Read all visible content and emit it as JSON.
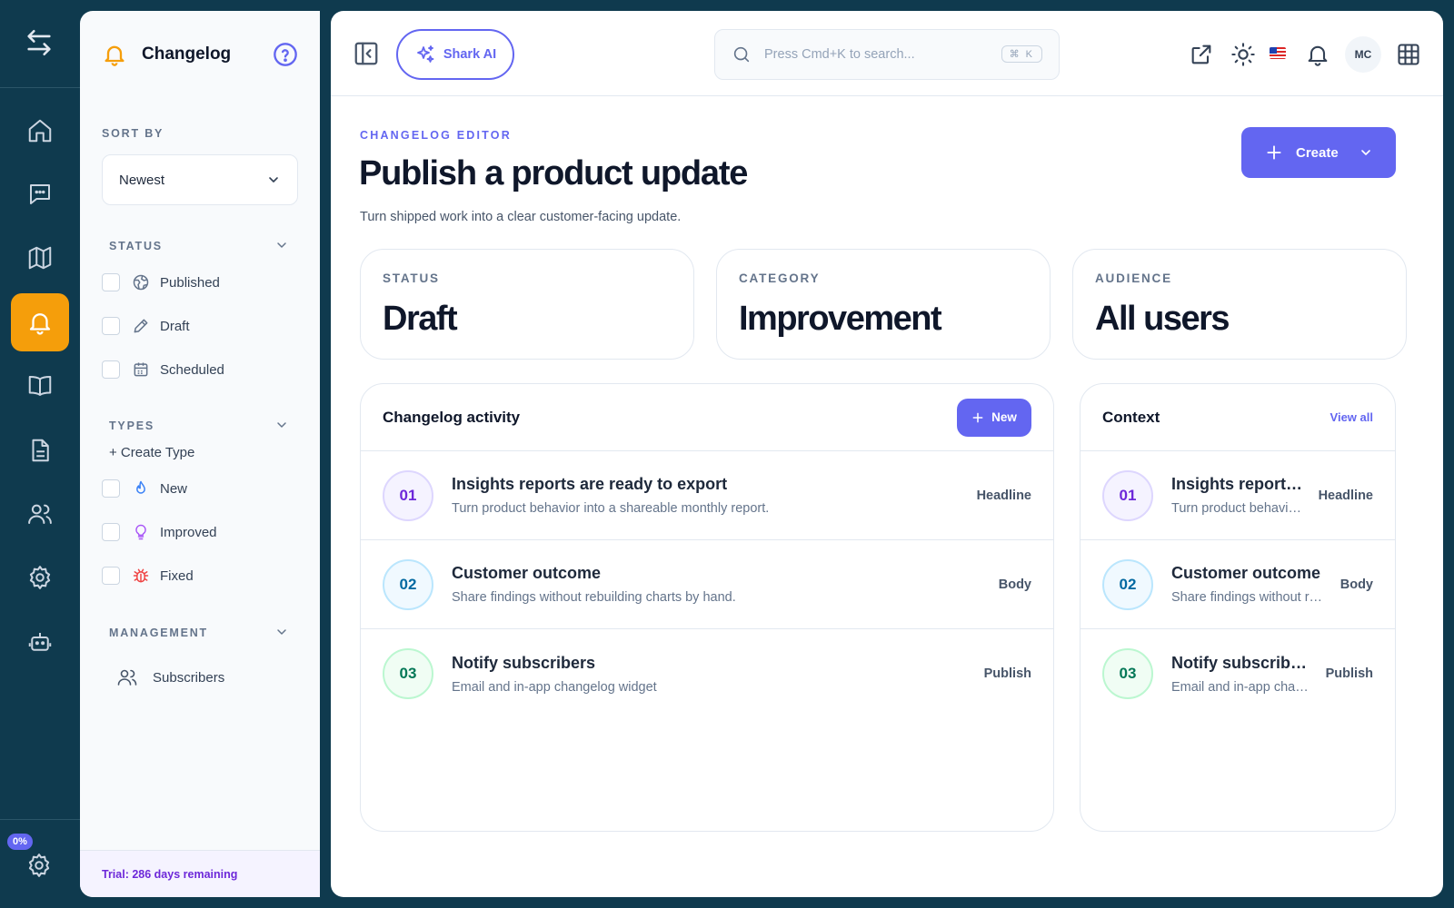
{
  "sidebar": {
    "title": "Changelog",
    "sort_by_label": "SORT BY",
    "sort_value": "Newest",
    "status_label": "STATUS",
    "status_items": [
      "Published",
      "Draft",
      "Scheduled"
    ],
    "types_label": "TYPES",
    "create_type": "+ Create Type",
    "type_items": [
      "New",
      "Improved",
      "Fixed"
    ],
    "management_label": "MANAGEMENT",
    "subscribers": "Subscribers",
    "trial": "Trial: 286 days remaining"
  },
  "rail": {
    "progress_badge": "0%"
  },
  "topbar": {
    "shark_ai": "Shark AI",
    "search_placeholder": "Press Cmd+K to search...",
    "search_shortcut": "⌘ K",
    "avatar_initials": "MC"
  },
  "header": {
    "eyebrow": "CHANGELOG EDITOR",
    "title": "Publish a product update",
    "subtitle": "Turn shipped work into a clear customer-facing update.",
    "create_label": "Create"
  },
  "stats": [
    {
      "label": "STATUS",
      "value": "Draft"
    },
    {
      "label": "CATEGORY",
      "value": "Improvement"
    },
    {
      "label": "AUDIENCE",
      "value": "All users"
    }
  ],
  "activity": {
    "title": "Changelog activity",
    "new_label": "New",
    "rows": [
      {
        "num": "01",
        "title": "Insights reports are ready to export",
        "desc": "Turn product behavior into a shareable monthly report.",
        "tag": "Headline"
      },
      {
        "num": "02",
        "title": "Customer outcome",
        "desc": "Share findings without rebuilding charts by hand.",
        "tag": "Body"
      },
      {
        "num": "03",
        "title": "Notify subscribers",
        "desc": "Email and in-app changelog widget",
        "tag": "Publish"
      }
    ]
  },
  "context": {
    "title": "Context",
    "view_all": "View all"
  },
  "colors": {
    "background": "#0f3a4e",
    "accent": "#6366f1",
    "active_rail": "#f59e0b"
  }
}
